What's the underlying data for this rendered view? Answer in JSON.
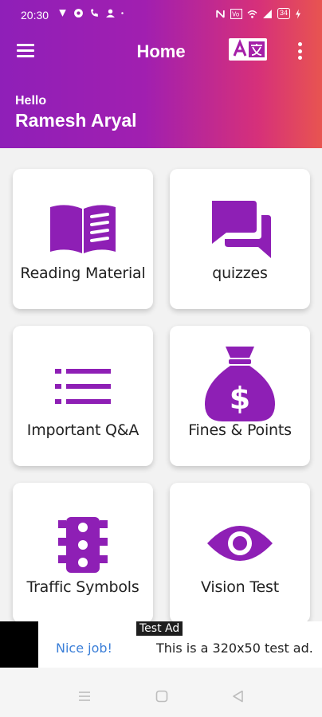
{
  "status_bar": {
    "time": "20:30",
    "battery": "34",
    "icons_left": [
      "vpn-icon",
      "app-icon",
      "call-icon",
      "person-icon",
      "dot-icon"
    ],
    "icons_right": [
      "nfc-icon",
      "volte-icon",
      "wifi-icon",
      "signal-icon",
      "battery-icon"
    ]
  },
  "appbar": {
    "title": "Home",
    "menu_icon": "menu-icon",
    "translate_icon": "translate-icon",
    "more_icon": "more-vert-icon"
  },
  "greeting": {
    "hello": "Hello",
    "name": "Ramesh Aryal"
  },
  "cards": [
    {
      "label": "Reading Material",
      "icon": "book-icon"
    },
    {
      "label": "quizzes",
      "icon": "chat-bubbles-icon"
    },
    {
      "label": "Important Q&A",
      "icon": "list-icon"
    },
    {
      "label": "Fines & Points",
      "icon": "money-bag-icon"
    },
    {
      "label": "Traffic Symbols",
      "icon": "traffic-light-icon"
    },
    {
      "label": "Vision Test",
      "icon": "eye-icon"
    }
  ],
  "ad": {
    "badge": "Test Ad",
    "nice_job": "Nice job!",
    "text": "This is a 320x50 test ad."
  },
  "colors": {
    "accent": "#8e1fb5",
    "header_start": "#8f1fb8",
    "header_end": "#e85450",
    "ad_link": "#3b7fd8"
  }
}
